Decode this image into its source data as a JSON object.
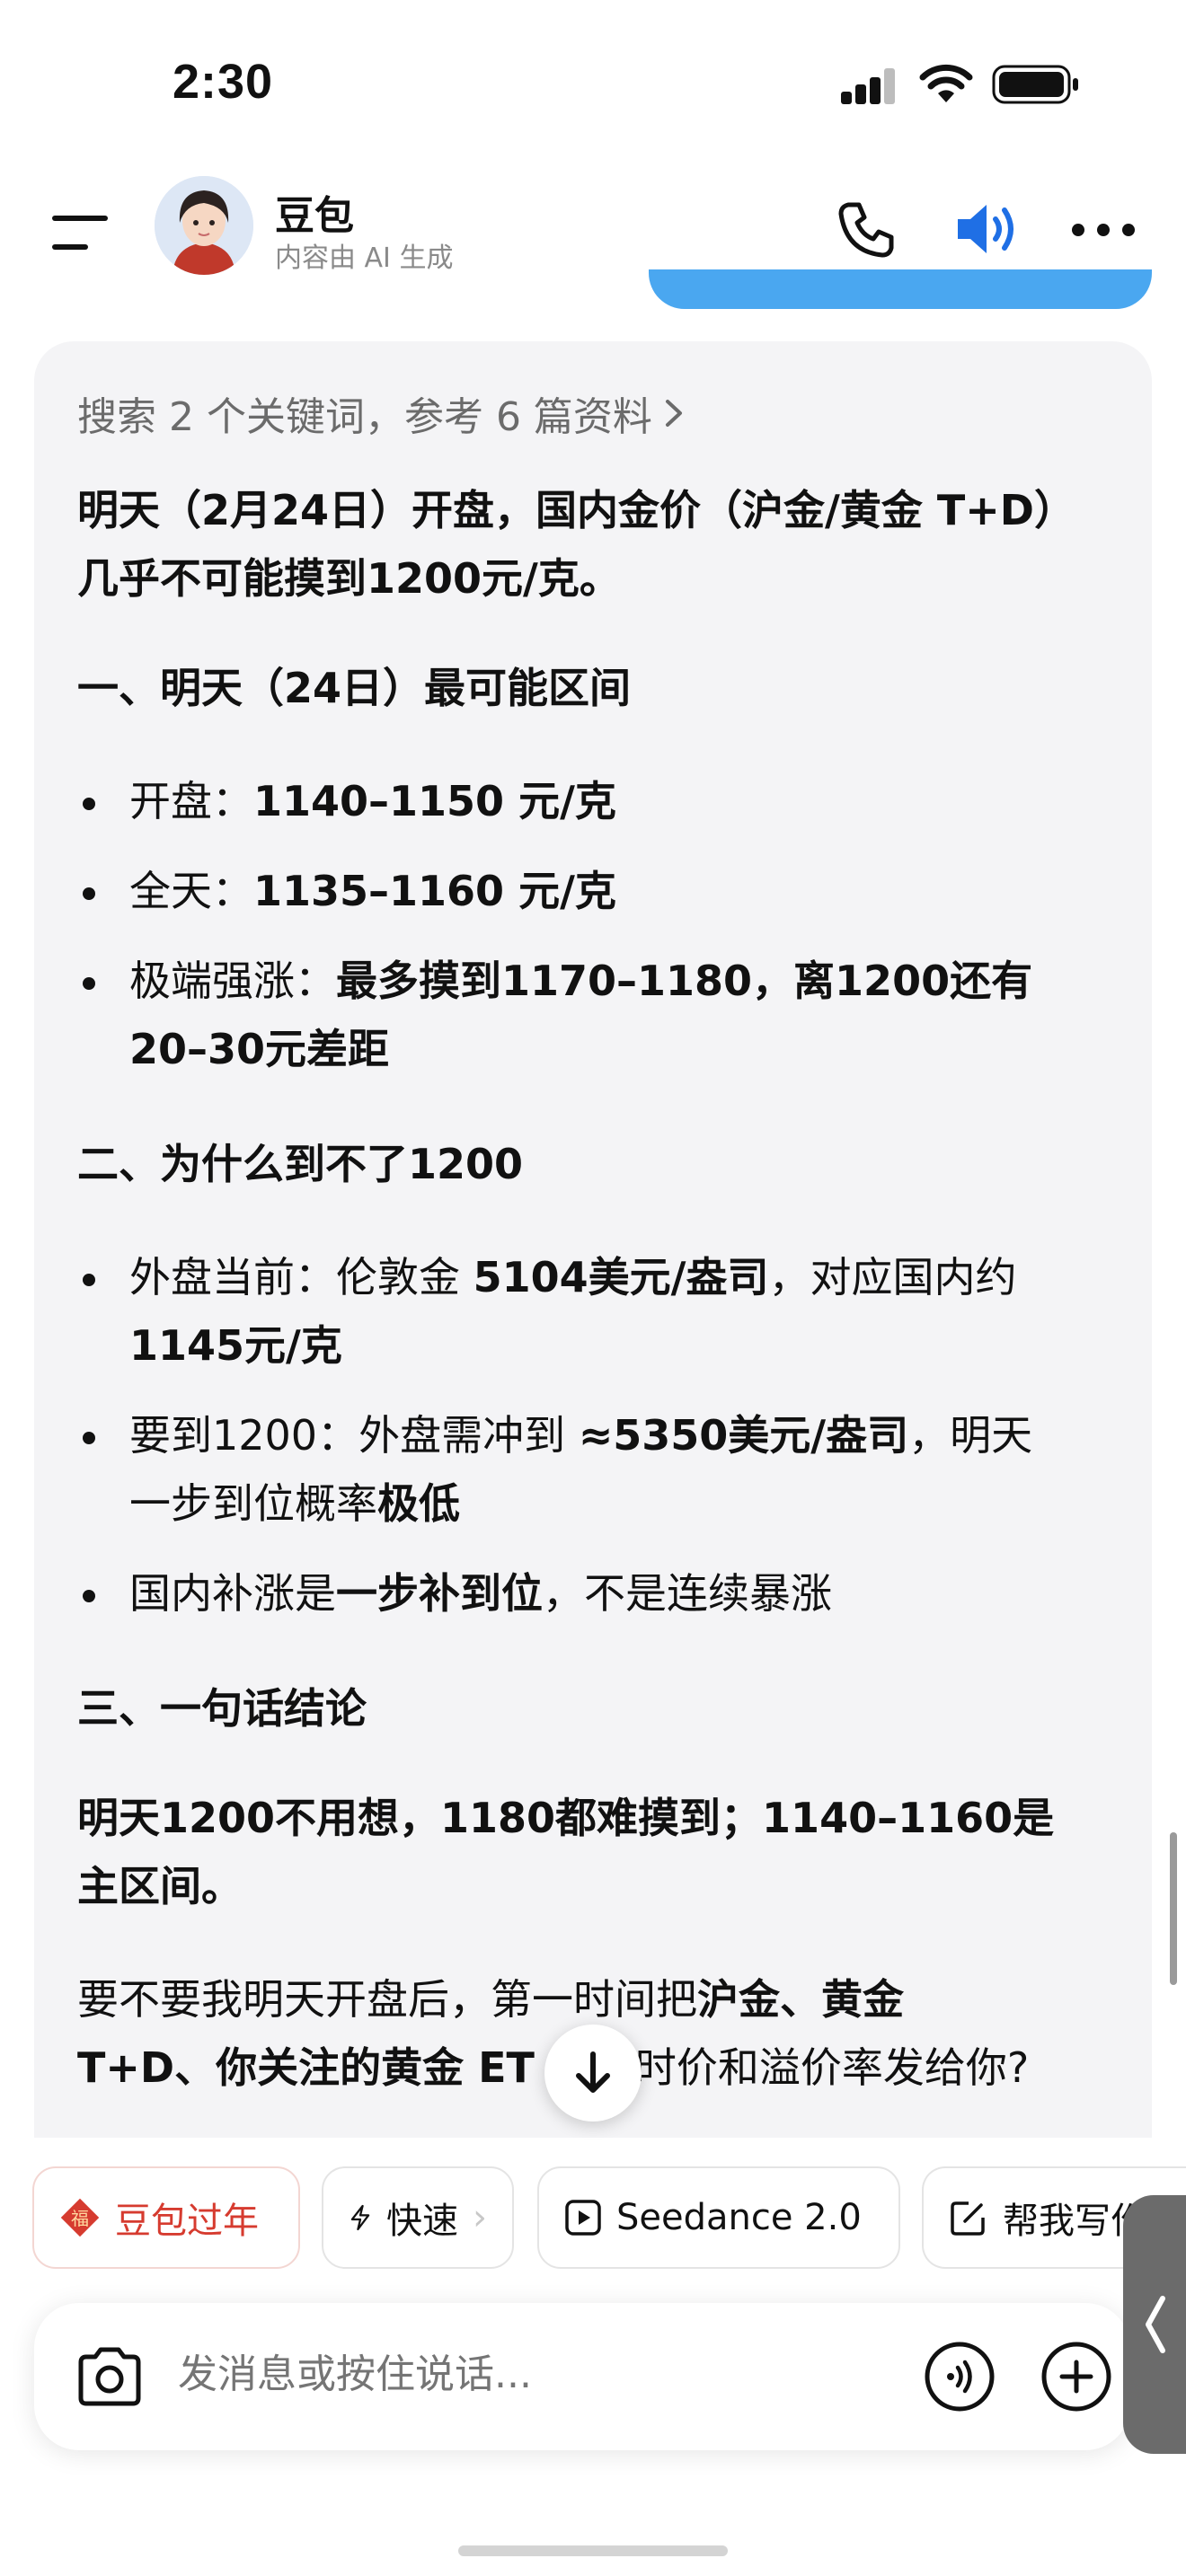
{
  "status_bar": {
    "time": "2:30"
  },
  "header": {
    "assistant_name": "豆包",
    "assistant_subtitle": "内容由 AI 生成"
  },
  "answer": {
    "search_summary": "搜索 2 个关键词，参考 6 篇资料",
    "intro": {
      "line1": "明天（2月24日）开盘，国内金价（沪金/黄金 T+D）",
      "line2": "几乎不可能摸到1200元/克。"
    },
    "section1": {
      "heading": "一、明天（24日）最可能区间",
      "items": [
        {
          "label": "开盘：",
          "value": "1140–1150 元/克"
        },
        {
          "label": "全天：",
          "value": "1135–1160 元/克"
        },
        {
          "label": "极端强涨：",
          "value_line1": "最多摸到1170–1180，离1200还有",
          "value_line2": "20–30元差距"
        }
      ]
    },
    "section2": {
      "heading": "二、为什么到不了1200",
      "items": [
        {
          "prefix": "外盘当前：伦敦金 ",
          "bold": "5104美元/盎司",
          "suffix": "，对应国内约",
          "line2_bold": "1145元/克"
        },
        {
          "prefix": "要到1200：外盘需冲到 ",
          "bold": "≈5350美元/盎司",
          "suffix": "，明天",
          "line2_prefix": "一步到位概率",
          "line2_bold": "极低"
        },
        {
          "prefix": "国内补涨是",
          "bold": "一步补到位",
          "suffix": "，不是连续暴涨"
        }
      ]
    },
    "section3": {
      "heading": "三、一句话结论",
      "conclusion_line1": "明天1200不用想，1180都难摸到；1140–1160是",
      "conclusion_line2": "主区间。"
    },
    "followup": {
      "line1_prefix": "要不要我明天开盘后，第一时间把",
      "line1_bold": "沪金、黄金",
      "line2_bold": "T+D、你关注的黄金 ET",
      "line2_suffix": "实时价和溢价率发给你?"
    }
  },
  "chips": [
    {
      "label": "豆包过年",
      "icon": "fortune-icon"
    },
    {
      "label": "快速",
      "icon": "lightning-icon"
    },
    {
      "label": "Seedance 2.0",
      "icon": "play-icon"
    },
    {
      "label": "帮我写作",
      "icon": "edit-icon"
    }
  ],
  "composer": {
    "placeholder": "发消息或按住说话..."
  },
  "colors": {
    "accent_blue": "#1f6fe5",
    "user_bubble": "#4aa7f0",
    "card_bg": "#f4f4f6",
    "festival_red": "#d63b2f"
  }
}
